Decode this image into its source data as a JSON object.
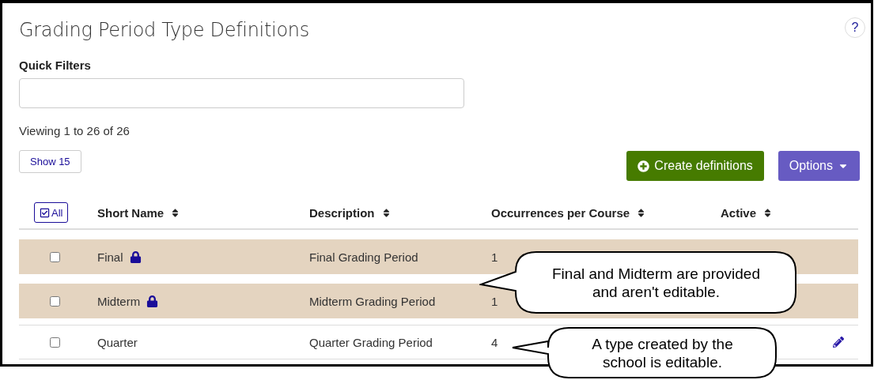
{
  "title": "Grading Period Type Definitions",
  "help": "?",
  "quick_filters": {
    "label": "Quick Filters"
  },
  "viewing": "Viewing 1 to 26 of 26",
  "show_button": "Show 15",
  "create_button": "Create definitions",
  "options_button": "Options",
  "select_all": "All",
  "columns": [
    "Short Name",
    "Description",
    "Occurrences per Course",
    "Active"
  ],
  "rows": [
    {
      "short_name": "Final",
      "description": "Final Grading Period",
      "occurrences": "1",
      "locked": true,
      "editable": false,
      "checked": false
    },
    {
      "short_name": "Midterm",
      "description": "Midterm Grading Period",
      "occurrences": "1",
      "locked": true,
      "editable": false,
      "checked": false
    },
    {
      "short_name": "Quarter",
      "description": "Quarter Grading Period",
      "occurrences": "4",
      "locked": false,
      "editable": true,
      "checked": false
    }
  ],
  "callouts": [
    {
      "text": "Final and Midterm are provided and aren't editable."
    },
    {
      "text": "A type created by the school is editable."
    }
  ]
}
